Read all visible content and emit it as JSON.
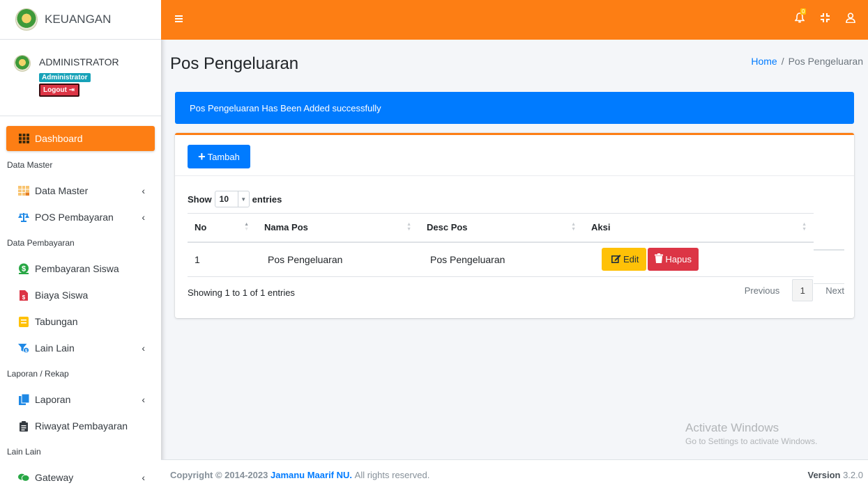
{
  "brand": {
    "title": "KEUANGAN"
  },
  "user": {
    "name": "ADMINISTRATOR",
    "role_badge": "Administrator",
    "logout_label": "Logout"
  },
  "sidebar": {
    "dashboard": "Dashboard",
    "header_data_master": "Data Master",
    "data_master": "Data Master",
    "pos_pembayaran": "POS Pembayaran",
    "header_data_pembayaran": "Data Pembayaran",
    "pembayaran_siswa": "Pembayaran Siswa",
    "biaya_siswa": "Biaya Siswa",
    "tabungan": "Tabungan",
    "lain_lain": "Lain Lain",
    "header_laporan": "Laporan / Rekap",
    "laporan": "Laporan",
    "riwayat_pembayaran": "Riwayat Pembayaran",
    "header_lain_lain": "Lain Lain",
    "gateway": "Gateway"
  },
  "topbar": {
    "notification_count": "0"
  },
  "page": {
    "title": "Pos Pengeluaran",
    "breadcrumb_home": "Home",
    "breadcrumb_sep": "/",
    "breadcrumb_current": "Pos Pengeluaran",
    "alert": "Pos Pengeluaran Has Been Added successfully"
  },
  "card": {
    "add_button": "Tambah",
    "show_label": "Show",
    "entries_value": "10",
    "entries_label": "entries",
    "columns": [
      "No",
      "Nama Pos",
      "Desc Pos",
      "Aksi"
    ],
    "rows": [
      {
        "no": "1",
        "nama_pos": "Pos Pengeluaran",
        "desc_pos": "Pos Pengeluaran"
      }
    ],
    "edit_label": "Edit",
    "delete_label": "Hapus",
    "info": "Showing 1 to 1 of 1 entries",
    "prev_label": "Previous",
    "page_number": "1",
    "next_label": "Next"
  },
  "watermark": {
    "line1": "Activate Windows",
    "line2": "Go to Settings to activate Windows."
  },
  "footer": {
    "copyright_prefix": "Copyright © 2014-2023",
    "org_name": "Jamanu Maarif NU.",
    "rights": "All rights reserved.",
    "version_label": "Version",
    "version_value": "3.2.0"
  },
  "colors": {
    "accent": "#fd7e14",
    "primary": "#007bff",
    "warning": "#ffc107",
    "danger": "#dc3545",
    "info": "#17a2b8"
  }
}
